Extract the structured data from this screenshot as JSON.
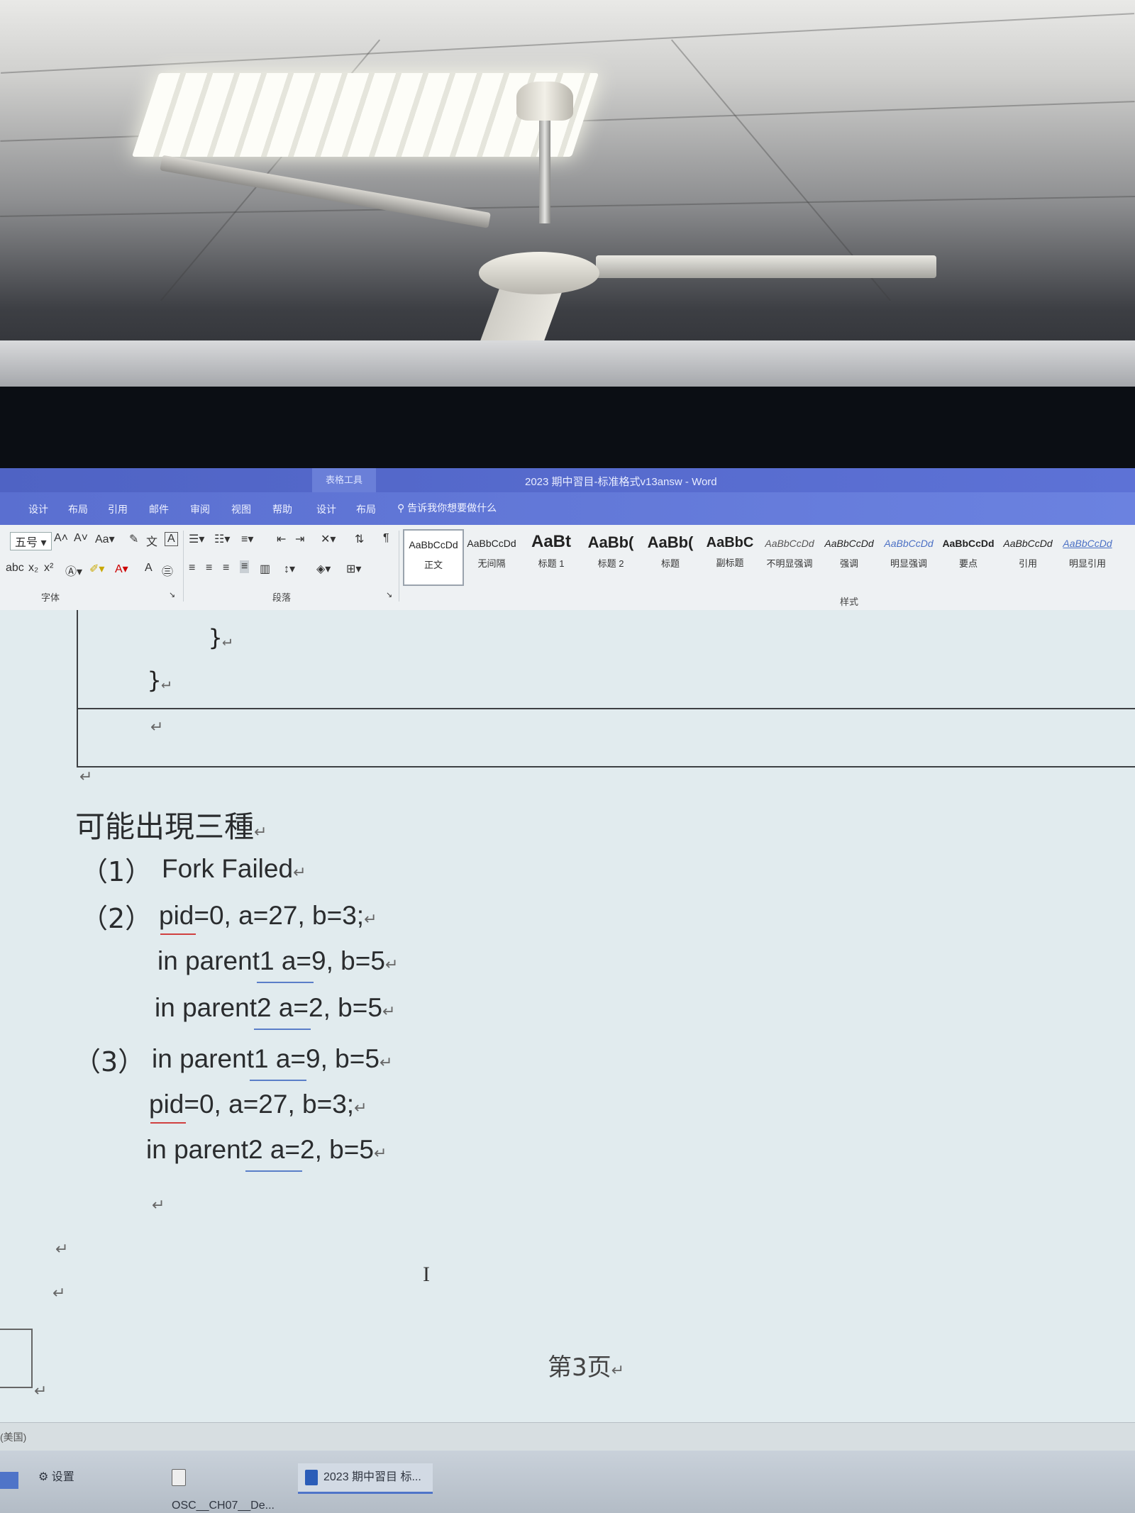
{
  "window": {
    "title": "2023 期中習目-标准格式v13answ  -  Word",
    "context_tab": "表格工具"
  },
  "tabs": [
    "设计",
    "布局",
    "引用",
    "邮件",
    "审阅",
    "视图",
    "帮助",
    "设计",
    "布局"
  ],
  "tell_me": "告诉我你想要做什么",
  "ribbon": {
    "font_size": "五号",
    "group_font": "字体",
    "group_paragraph": "段落",
    "group_styles": "样式",
    "styles": [
      {
        "sample": "AaBbCcDd",
        "name": "正文"
      },
      {
        "sample": "AaBbCcDd",
        "name": "无间隔"
      },
      {
        "sample": "AaBt",
        "name": "标题 1"
      },
      {
        "sample": "AaBb(",
        "name": "标题 2"
      },
      {
        "sample": "AaBb(",
        "name": "标题"
      },
      {
        "sample": "AaBbC",
        "name": "副标题"
      },
      {
        "sample": "AaBbCcDd",
        "name": "不明显强调"
      },
      {
        "sample": "AaBbCcDd",
        "name": "强调"
      },
      {
        "sample": "AaBbCcDd",
        "name": "明显强调"
      },
      {
        "sample": "AaBbCcDd",
        "name": "要点"
      },
      {
        "sample": "AaBbCcDd",
        "name": "引用"
      },
      {
        "sample": "AaBbCcDd",
        "name": "明显引用"
      }
    ]
  },
  "document": {
    "code_line1": "}",
    "code_line2": "}",
    "heading": "可能出現三種",
    "items": [
      {
        "num": "（1）",
        "lines": [
          "Fork Failed"
        ]
      },
      {
        "num": "（2）",
        "lines": [
          "pid=0, a=27, b=3;",
          "in parent1    a=9, b=5",
          "in parent2    a=2, b=5"
        ]
      },
      {
        "num": "（3）",
        "lines": [
          "in parent1    a=9, b=5",
          "pid=0, a=27, b=3;",
          "in parent2    a=2, b=5"
        ]
      }
    ],
    "page_number": "第3页"
  },
  "status": {
    "left": "(美国)"
  },
  "taskbar": [
    {
      "label": "设置"
    },
    {
      "label": "OSC__CH07__De..."
    },
    {
      "label": "2023 期中習目 标..."
    }
  ],
  "colors": {
    "title_bar": "#5b6fd0",
    "ribbon": "#eef1f3",
    "page": "#e1ebee"
  }
}
